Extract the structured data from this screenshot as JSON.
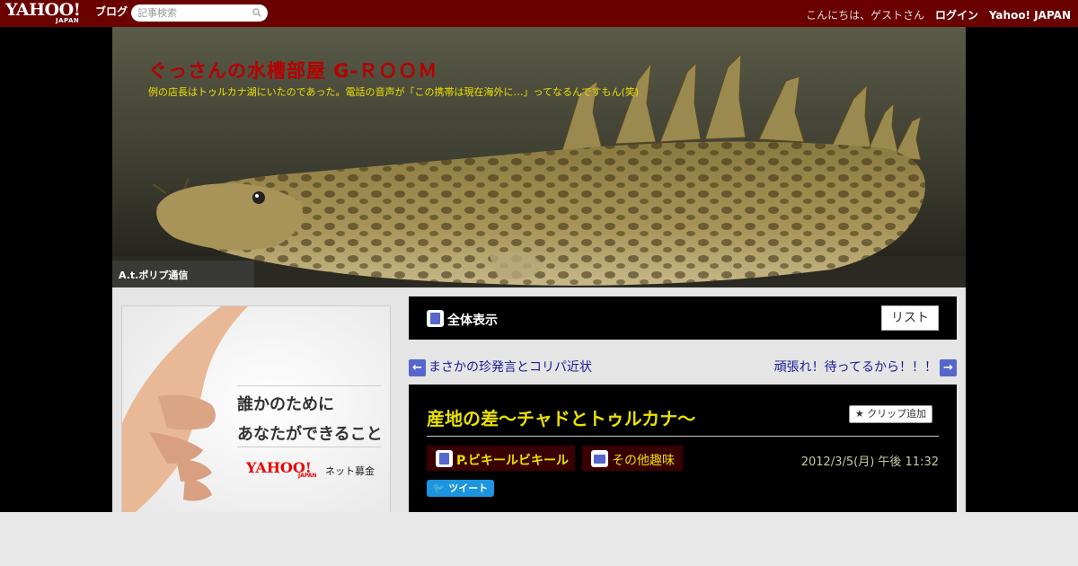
{
  "topbar": {
    "logo_yahoo": "YAHOO!",
    "logo_japan": "JAPAN",
    "logo_blog": "ブログ",
    "search_placeholder": "記事検索",
    "greeting": "こんにちは、ゲストさん",
    "login": "ログイン",
    "yahoo_japan": "Yahoo! JAPAN"
  },
  "header": {
    "blog_title": "ぐっさんの水槽部屋 G-ＲＯＯＭ",
    "description": "例の店長はトゥルカナ湖にいたのであった。電話の音声が「この携帯は現在海外に…」ってなるんですもん(笑)",
    "tab_label": "A.t.ポリプ通信"
  },
  "ad": {
    "line1": "誰かのために",
    "line2": "あなたができること",
    "logo": "YAHOO!",
    "logo_sub": "JAPAN",
    "service": "ネット募金"
  },
  "panel": {
    "label": "全体表示",
    "list_button": "リスト"
  },
  "nav": {
    "prev": "まさかの珍発言とコリパ近状",
    "next": "頑張れ！待ってるから！！！",
    "prev_arrow": "←",
    "next_arrow": "→"
  },
  "article": {
    "title": "産地の差～チャドとトゥルカナ～",
    "clip_button": "クリップ追加",
    "category": "P.ビキールビキール",
    "folder": "その他趣味",
    "date": "2012/3/5(月) 午後 11:32",
    "tweet": "ツイート"
  },
  "colors": {
    "topbar": "#6a0000",
    "title_red": "#b50000",
    "accent_yellow": "#e8e000",
    "link_blue": "#1a1a9a",
    "icon_blue": "#5566cc"
  }
}
